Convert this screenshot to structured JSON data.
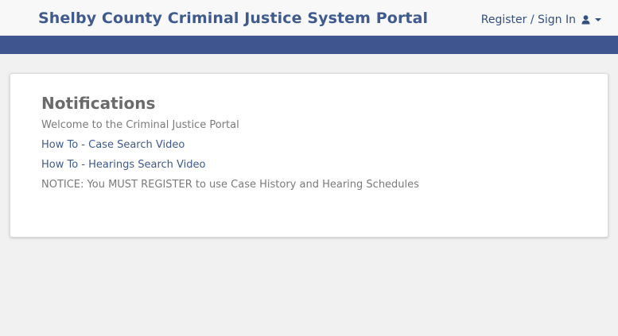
{
  "header": {
    "title": "Shelby County Criminal Justice System Portal",
    "auth_label": "Register / Sign In",
    "auth_icon": "user-icon",
    "dropdown_icon": "caret-down-icon",
    "brand_color": "#3f5a8c",
    "nav_band_color": "#3e5590"
  },
  "notifications": {
    "heading": "Notifications",
    "welcome": "Welcome to the Criminal Justice Portal",
    "links": [
      "How To - Case Search Video",
      "How To - Hearings Search Video"
    ],
    "notice": "NOTICE: You MUST REGISTER to use Case History and Hearing Schedules"
  }
}
